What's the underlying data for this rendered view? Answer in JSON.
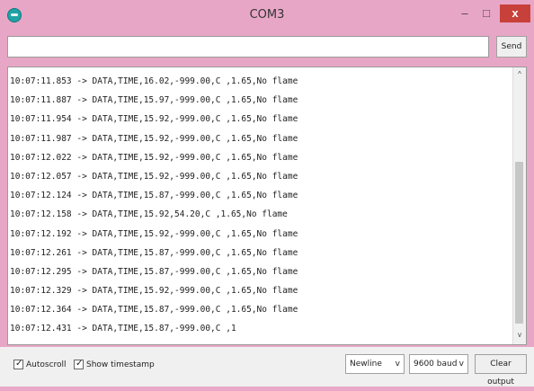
{
  "window": {
    "title": "COM3"
  },
  "controls": {
    "minimize": "–",
    "maximize": "□",
    "close": "x"
  },
  "send": {
    "input_value": "",
    "button_label": "Send"
  },
  "output": {
    "lines": [
      "10:07:11.853 -> DATA,TIME,16.02,-999.00,C ,1.65,No flame",
      "10:07:11.887 -> DATA,TIME,15.97,-999.00,C ,1.65,No flame",
      "10:07:11.954 -> DATA,TIME,15.92,-999.00,C ,1.65,No flame",
      "10:07:11.987 -> DATA,TIME,15.92,-999.00,C ,1.65,No flame",
      "10:07:12.022 -> DATA,TIME,15.92,-999.00,C ,1.65,No flame",
      "10:07:12.057 -> DATA,TIME,15.92,-999.00,C ,1.65,No flame",
      "10:07:12.124 -> DATA,TIME,15.87,-999.00,C ,1.65,No flame",
      "10:07:12.158 -> DATA,TIME,15.92,54.20,C ,1.65,No flame",
      "10:07:12.192 -> DATA,TIME,15.92,-999.00,C ,1.65,No flame",
      "10:07:12.261 -> DATA,TIME,15.87,-999.00,C ,1.65,No flame",
      "10:07:12.295 -> DATA,TIME,15.87,-999.00,C ,1.65,No flame",
      "10:07:12.329 -> DATA,TIME,15.92,-999.00,C ,1.65,No flame",
      "10:07:12.364 -> DATA,TIME,15.87,-999.00,C ,1.65,No flame",
      "10:07:12.431 -> DATA,TIME,15.87,-999.00,C ,1"
    ]
  },
  "scrollbar": {
    "up": "^",
    "down": "v"
  },
  "footer": {
    "autoscroll_label": "Autoscroll",
    "timestamp_label": "Show timestamp",
    "line_ending": "Newline",
    "baud": "9600 baud",
    "dropdown_arrow": "v",
    "clear_label": "Clear output"
  }
}
